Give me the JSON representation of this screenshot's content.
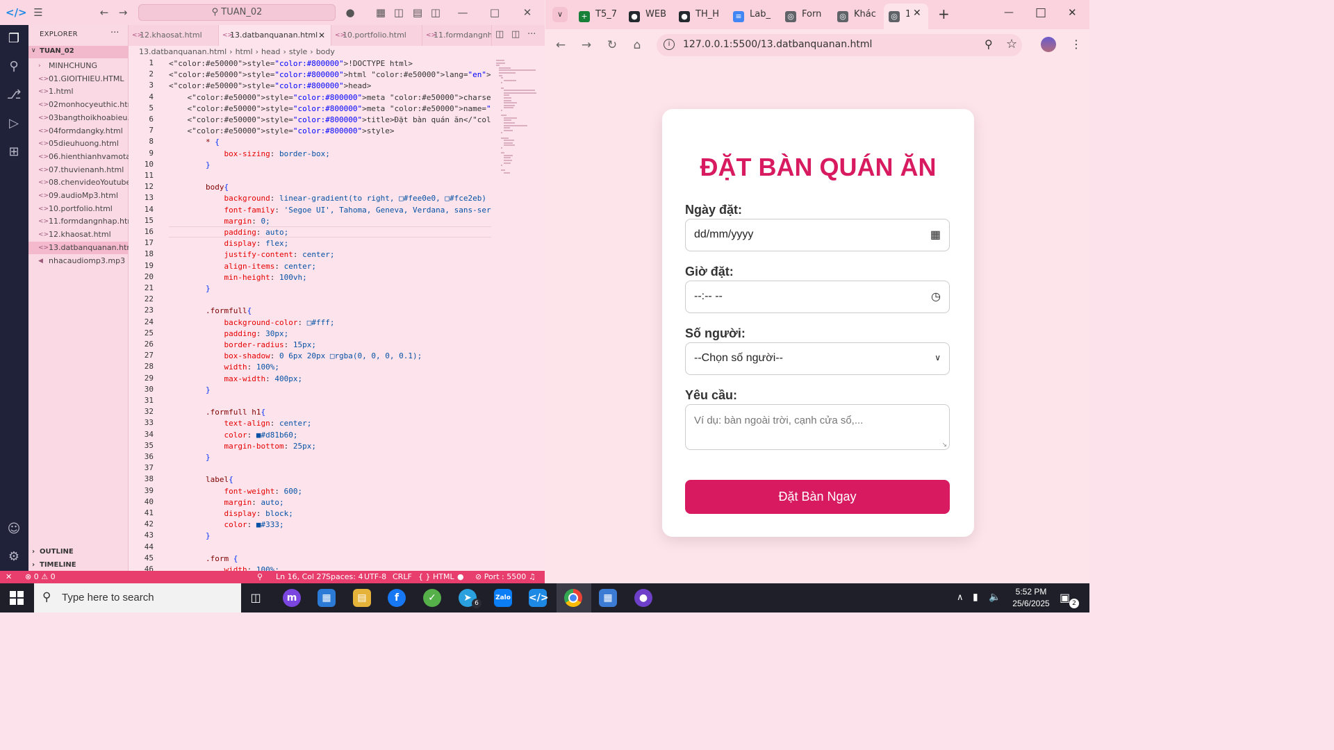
{
  "vscode": {
    "search_label": "TUAN_02",
    "explorer_title": "EXPLORER",
    "folder": "TUAN_02",
    "files": [
      {
        "name": "MINHCHUNG",
        "type": "folder"
      },
      {
        "name": "01.GIOITHIEU.HTML",
        "type": "html"
      },
      {
        "name": "1.html",
        "type": "html"
      },
      {
        "name": "02monhocyeuthic.html",
        "type": "html"
      },
      {
        "name": "03bangthoikhoabieu....",
        "type": "html"
      },
      {
        "name": "04formdangky.html",
        "type": "html"
      },
      {
        "name": "05dieuhuong.html",
        "type": "html"
      },
      {
        "name": "06.hienthianhvamota....",
        "type": "html"
      },
      {
        "name": "07.thuvienanh.html",
        "type": "html"
      },
      {
        "name": "08.chenvideoYoutube....",
        "type": "html"
      },
      {
        "name": "09.audioMp3.html",
        "type": "html"
      },
      {
        "name": "10.portfolio.html",
        "type": "html"
      },
      {
        "name": "11.formdangnhap.html",
        "type": "html"
      },
      {
        "name": "12.khaosat.html",
        "type": "html"
      },
      {
        "name": "13.datbanquanan.html",
        "type": "html",
        "active": true
      },
      {
        "name": "nhacaudiomp3.mp3",
        "type": "audio"
      }
    ],
    "outline": "OUTLINE",
    "timeline": "TIMELINE",
    "tabs": [
      "12.khaosat.html",
      "13.datbanquanan.html",
      "10.portfolio.html",
      "11.formdangnhap.html"
    ],
    "active_tab": 1,
    "breadcrumb": [
      "13.datbanquanan.html",
      "html",
      "head",
      "style",
      "body"
    ],
    "code_lines": [
      "<!DOCTYPE html>",
      "<html lang=\"en\">",
      "<head>",
      "    <meta charset=\"UTF-8\">",
      "    <meta name=\"viewport\" content=\"width=device-width, initial-scale=1.",
      "    <title>Đặt bàn quán ăn</title>",
      "    <style>",
      "        * {",
      "            box-sizing: border-box;",
      "        }",
      "",
      "        body{",
      "            background: linear-gradient(to right, □#fee0e0, □#fce2eb)",
      "            font-family: 'Segoe UI', Tahoma, Geneva, Verdana, sans-seri",
      "            margin: 0;",
      "            padding: auto;",
      "            display: flex;",
      "            justify-content: center;",
      "            align-items: center;",
      "            min-height: 100vh;",
      "        }",
      "",
      "        .formfull{",
      "            background-color: □#fff;",
      "            padding: 30px;",
      "            border-radius: 15px;",
      "            box-shadow: 0 6px 20px □rgba(0, 0, 0, 0.1);",
      "            width: 100%;",
      "            max-width: 400px;",
      "        }",
      "",
      "        .formfull h1{",
      "            text-align: center;",
      "            color: ■#d81b60;",
      "            margin-bottom: 25px;",
      "        }",
      "",
      "        label{",
      "            font-weight: 600;",
      "            margin: auto;",
      "            display: block;",
      "            color: ■#333;",
      "        }",
      "",
      "        .form {",
      "            width: 100%;"
    ],
    "status": {
      "errors": "⊗ 0 ⚠ 0",
      "position": "Ln 16, Col 27",
      "spaces": "Spaces: 4",
      "encoding": "UTF-8",
      "eol": "CRLF",
      "language": "{ } HTML",
      "port": "⊘ Port : 5500"
    }
  },
  "browser": {
    "tabs": [
      {
        "label": "T5_7",
        "icon": "sheets-icon",
        "color": "#188038"
      },
      {
        "label": "WEB",
        "icon": "github-icon",
        "color": "#24292f"
      },
      {
        "label": "TH_H",
        "icon": "github-icon",
        "color": "#24292f"
      },
      {
        "label": "Lab_",
        "icon": "docs-icon",
        "color": "#4285f4"
      },
      {
        "label": "Forn",
        "icon": "globe-icon",
        "color": "#5f6368"
      },
      {
        "label": "Khác",
        "icon": "globe-icon",
        "color": "#5f6368"
      },
      {
        "label": "1",
        "icon": "globe-icon",
        "color": "#5f6368"
      }
    ],
    "url": "127.0.0.1:5500/13.datbanquanan.html",
    "form": {
      "title": "ĐẶT BÀN QUÁN ĂN",
      "date_label": "Ngày đặt:",
      "date_value": "dd/mm/yyyy",
      "time_label": "Giờ đặt:",
      "time_value": "--:-- --",
      "people_label": "Số người:",
      "people_value": "--Chọn số người--",
      "request_label": "Yêu cầu:",
      "request_placeholder": "Ví dụ: bàn ngoài trời, cạnh cửa sổ,...",
      "submit_label": "Đặt Bàn Ngay",
      "accent_color": "#d81b60"
    }
  },
  "taskbar": {
    "search_placeholder": "Type here to search",
    "time": "5:52 PM",
    "date": "25/6/2025",
    "telegram_badge": "6",
    "notification_badge": "2"
  }
}
